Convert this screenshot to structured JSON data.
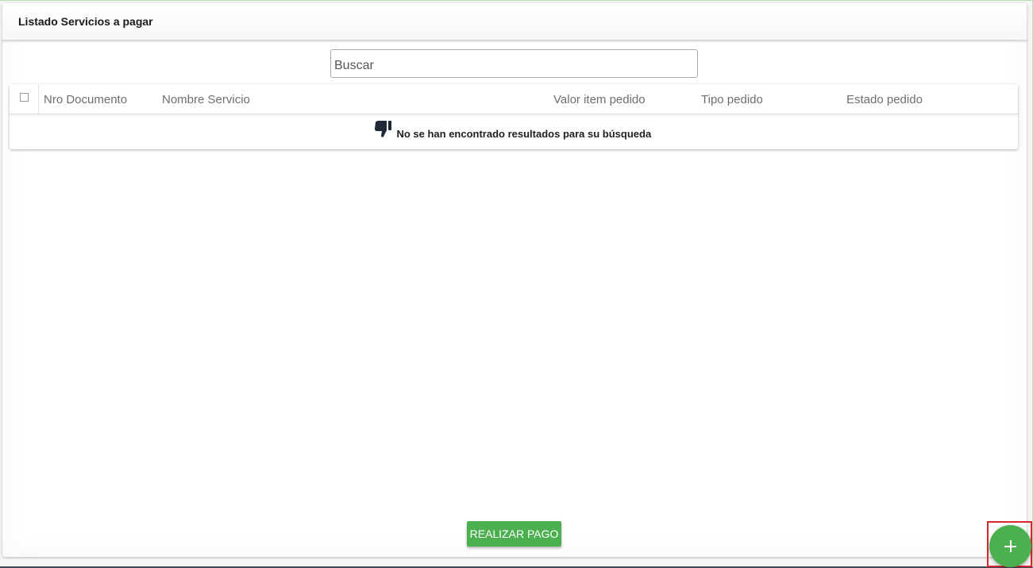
{
  "header": {
    "title": "Listado Servicios a pagar"
  },
  "search": {
    "placeholder": "Buscar",
    "value": ""
  },
  "table": {
    "columns": [
      "Nro Documento",
      "Nombre Servicio",
      "Valor item pedido",
      "Tipo pedido",
      "Estado pedido"
    ],
    "rows": [],
    "empty_message": "No se han encontrado resultados para su búsqueda",
    "empty_icon": "thumbs-down-icon"
  },
  "actions": {
    "pay_label": "REALIZAR PAGO",
    "fab_icon": "plus-icon"
  },
  "colors": {
    "accent": "#4caf50",
    "highlight": "#d8262e"
  }
}
